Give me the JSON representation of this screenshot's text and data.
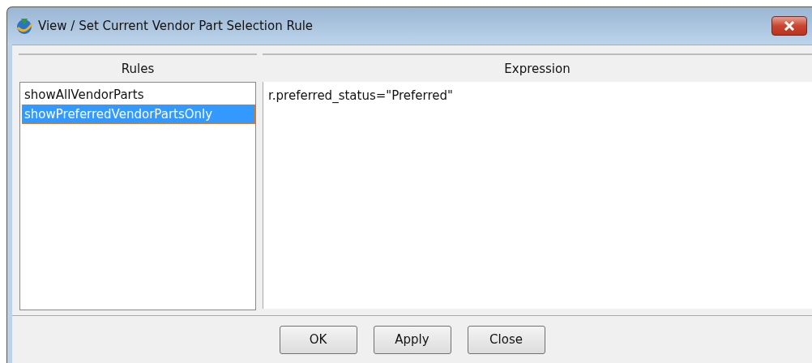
{
  "window": {
    "title": "View / Set Current Vendor Part Selection Rule"
  },
  "rules": {
    "heading": "Rules",
    "items": [
      {
        "label": "showAllVendorParts",
        "selected": false
      },
      {
        "label": "showPreferredVendorPartsOnly",
        "selected": true
      }
    ]
  },
  "expression": {
    "heading": "Expression",
    "text": "r.preferred_status=\"Preferred\""
  },
  "buttons": [
    "OK",
    "Apply",
    "Close"
  ]
}
